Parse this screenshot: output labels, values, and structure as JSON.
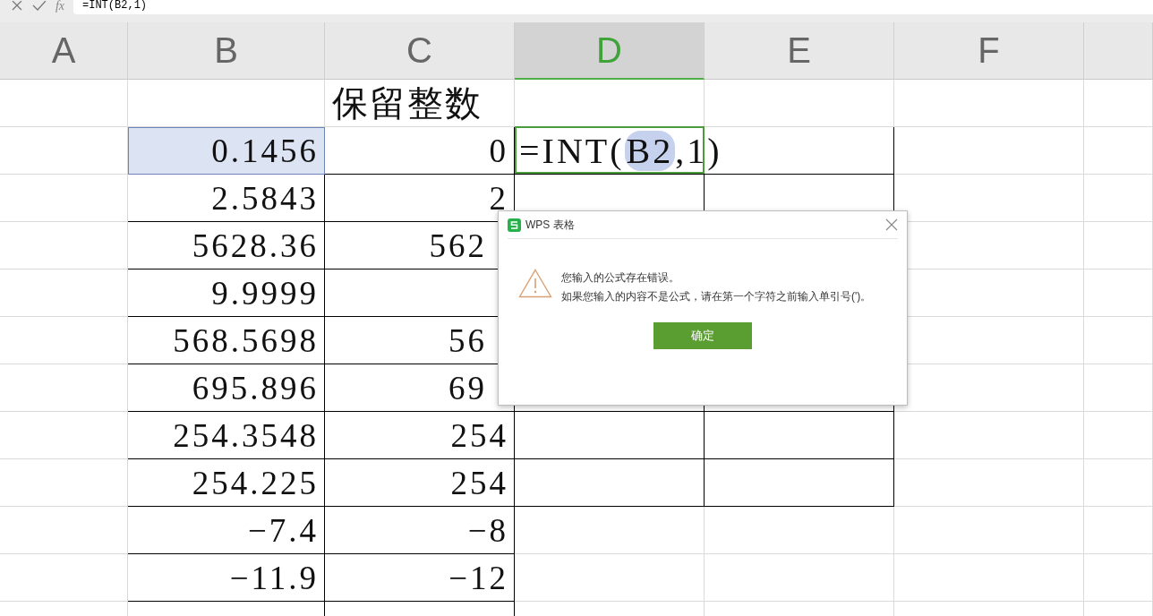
{
  "formula_bar": {
    "fx": "fx",
    "value": "=INT(B2,1)"
  },
  "columns": [
    {
      "label": "A",
      "selected": false
    },
    {
      "label": "B",
      "selected": false
    },
    {
      "label": "C",
      "selected": false
    },
    {
      "label": "D",
      "selected": true
    },
    {
      "label": "E",
      "selected": false
    },
    {
      "label": "F",
      "selected": false
    }
  ],
  "rows": [
    {
      "kind": "plain",
      "cells": {
        "C": {
          "text": "保留整数"
        }
      }
    },
    {
      "kind": "boxed4",
      "cells": {
        "B": {
          "text": "0.1456",
          "referenced": true
        },
        "C": {
          "text": "0"
        },
        "D": {
          "active": true,
          "formula": {
            "before": "=INT(",
            "reference": "B2",
            "after": ",1)"
          }
        }
      }
    },
    {
      "kind": "boxed4",
      "cells": {
        "B": {
          "text": "2.5843"
        },
        "C": {
          "text": "2"
        }
      }
    },
    {
      "kind": "boxed4",
      "cells": {
        "B": {
          "text": "5628.36"
        },
        "C": {
          "text": "562",
          "covered": true
        }
      }
    },
    {
      "kind": "boxed4",
      "cells": {
        "B": {
          "text": "9.9999"
        }
      }
    },
    {
      "kind": "boxed4",
      "cells": {
        "B": {
          "text": "568.5698"
        },
        "C": {
          "text": "56",
          "covered": true
        }
      }
    },
    {
      "kind": "boxed4",
      "cells": {
        "B": {
          "text": "695.896"
        },
        "C": {
          "text": "69",
          "covered": true
        }
      }
    },
    {
      "kind": "boxed4",
      "cells": {
        "B": {
          "text": "254.3548"
        },
        "C": {
          "text": "254"
        }
      }
    },
    {
      "kind": "boxed4",
      "cells": {
        "B": {
          "text": "254.225"
        },
        "C": {
          "text": "254"
        }
      }
    },
    {
      "kind": "boxed2",
      "cells": {
        "B": {
          "text": "−7.4"
        },
        "C": {
          "text": "−8"
        }
      }
    },
    {
      "kind": "boxed2",
      "cells": {
        "B": {
          "text": "−11.9"
        },
        "C": {
          "text": "−12"
        }
      }
    },
    {
      "kind": "boxed2",
      "cells": {}
    }
  ],
  "dialog": {
    "title": "WPS 表格",
    "message": [
      "您输入的公式存在错误。",
      "如果您输入的内容不是公式，请在第一个字符之前输入单引号(')。"
    ],
    "button": "确定"
  }
}
